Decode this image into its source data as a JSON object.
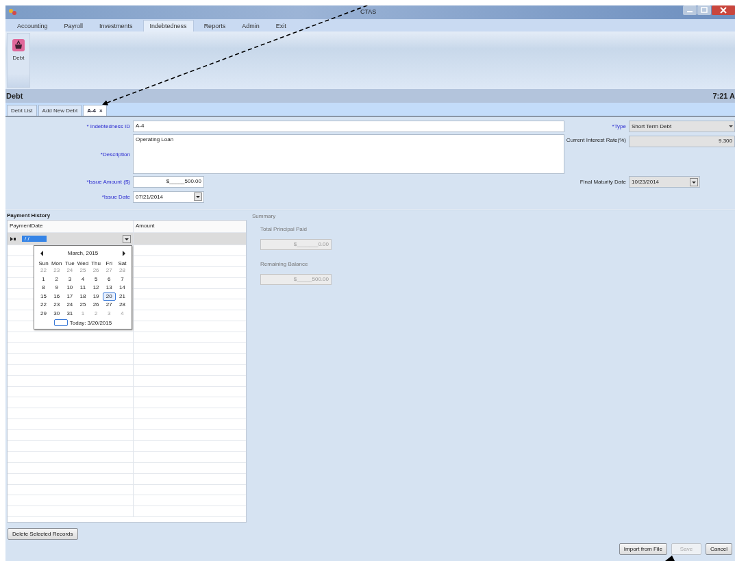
{
  "window": {
    "title": "CTAS"
  },
  "menu": [
    {
      "label": "Accounting",
      "selected": false
    },
    {
      "label": "Payroll",
      "selected": false
    },
    {
      "label": "Investments",
      "selected": false
    },
    {
      "label": "Indebtedness",
      "selected": true
    },
    {
      "label": "Reports",
      "selected": false
    },
    {
      "label": "Admin",
      "selected": false
    },
    {
      "label": "Exit",
      "selected": false
    }
  ],
  "ribbon": {
    "button": "Debt"
  },
  "header": {
    "title": "Debt",
    "time": "7:21 A"
  },
  "doc_tabs": [
    {
      "label": "Debt List",
      "selected": false,
      "closable": false
    },
    {
      "label": "Add New Debt",
      "selected": false,
      "closable": false
    },
    {
      "label": "A-4",
      "selected": true,
      "closable": true,
      "close": "×"
    }
  ],
  "form": {
    "id": {
      "label": "* Indebtedness ID",
      "required": true,
      "value": "A-4"
    },
    "description": {
      "label": "*Description",
      "required": true,
      "value": "Operating Loan"
    },
    "amount": {
      "label": "*Issue Amount ($)",
      "required": true,
      "value": "$_____500.00"
    },
    "issue_date": {
      "label": "*Issue Date",
      "required": true,
      "value": "07/21/2014"
    },
    "type": {
      "label": "*Type",
      "required": true,
      "value": "Short Term Debt"
    },
    "rate": {
      "label": "Current Interest Rate(%)",
      "required": false,
      "value": "9.300"
    },
    "maturity": {
      "label": "Final Maturity Date",
      "required": false,
      "value": "10/23/2014"
    }
  },
  "payment_history": {
    "title": "Payment History",
    "columns": [
      "PaymentDate",
      "Amount"
    ],
    "editor_value": "/ /",
    "calendar": {
      "month": "March, 2015",
      "weekdays": [
        "Sun",
        "Mon",
        "Tue",
        "Wed",
        "Thu",
        "Fri",
        "Sat"
      ],
      "weeks": [
        [
          {
            "day": "22",
            "other_month": true,
            "selected": false
          },
          {
            "day": "23",
            "other_month": true,
            "selected": false
          },
          {
            "day": "24",
            "other_month": true,
            "selected": false
          },
          {
            "day": "25",
            "other_month": true,
            "selected": false
          },
          {
            "day": "26",
            "other_month": true,
            "selected": false
          },
          {
            "day": "27",
            "other_month": true,
            "selected": false
          },
          {
            "day": "28",
            "other_month": true,
            "selected": false
          }
        ],
        [
          {
            "day": "1",
            "other_month": false,
            "selected": false
          },
          {
            "day": "2",
            "other_month": false,
            "selected": false
          },
          {
            "day": "3",
            "other_month": false,
            "selected": false
          },
          {
            "day": "4",
            "other_month": false,
            "selected": false
          },
          {
            "day": "5",
            "other_month": false,
            "selected": false
          },
          {
            "day": "6",
            "other_month": false,
            "selected": false
          },
          {
            "day": "7",
            "other_month": false,
            "selected": false
          }
        ],
        [
          {
            "day": "8",
            "other_month": false,
            "selected": false
          },
          {
            "day": "9",
            "other_month": false,
            "selected": false
          },
          {
            "day": "10",
            "other_month": false,
            "selected": false
          },
          {
            "day": "11",
            "other_month": false,
            "selected": false
          },
          {
            "day": "12",
            "other_month": false,
            "selected": false
          },
          {
            "day": "13",
            "other_month": false,
            "selected": false
          },
          {
            "day": "14",
            "other_month": false,
            "selected": false
          }
        ],
        [
          {
            "day": "15",
            "other_month": false,
            "selected": false
          },
          {
            "day": "16",
            "other_month": false,
            "selected": false
          },
          {
            "day": "17",
            "other_month": false,
            "selected": false
          },
          {
            "day": "18",
            "other_month": false,
            "selected": false
          },
          {
            "day": "19",
            "other_month": false,
            "selected": false
          },
          {
            "day": "20",
            "other_month": false,
            "selected": true
          },
          {
            "day": "21",
            "other_month": false,
            "selected": false
          }
        ],
        [
          {
            "day": "22",
            "other_month": false,
            "selected": false
          },
          {
            "day": "23",
            "other_month": false,
            "selected": false
          },
          {
            "day": "24",
            "other_month": false,
            "selected": false
          },
          {
            "day": "25",
            "other_month": false,
            "selected": false
          },
          {
            "day": "26",
            "other_month": false,
            "selected": false
          },
          {
            "day": "27",
            "other_month": false,
            "selected": false
          },
          {
            "day": "28",
            "other_month": false,
            "selected": false
          }
        ],
        [
          {
            "day": "29",
            "other_month": false,
            "selected": false
          },
          {
            "day": "30",
            "other_month": false,
            "selected": false
          },
          {
            "day": "31",
            "other_month": false,
            "selected": false
          },
          {
            "day": "1",
            "other_month": true,
            "selected": false
          },
          {
            "day": "2",
            "other_month": true,
            "selected": false
          },
          {
            "day": "3",
            "other_month": true,
            "selected": false
          },
          {
            "day": "4",
            "other_month": true,
            "selected": false
          }
        ]
      ],
      "today": "Today: 3/20/2015"
    }
  },
  "summary": {
    "title": "Summary",
    "fields": [
      {
        "label": "Total Principal Paid",
        "value": "$_______0.00"
      },
      {
        "label": "Remaining Balance",
        "value": "$_____500.00"
      }
    ]
  },
  "delete_button": "Delete Selected Records",
  "buttons": [
    {
      "label": "Import from File",
      "disabled": false
    },
    {
      "label": "Save",
      "disabled": true
    },
    {
      "label": "Cancel",
      "disabled": false
    }
  ]
}
